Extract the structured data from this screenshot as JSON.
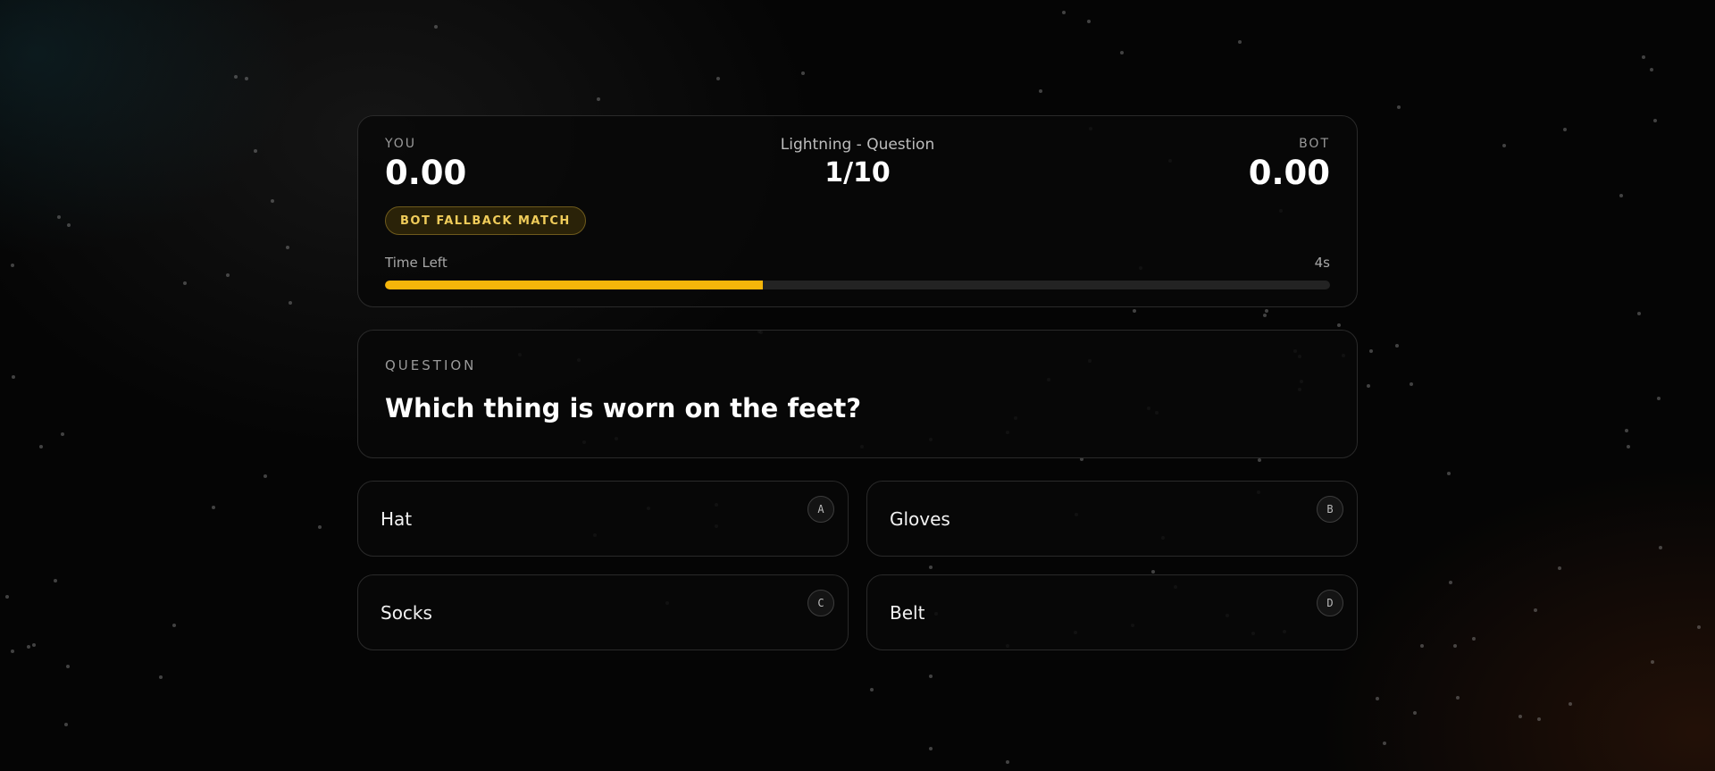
{
  "scoreboard": {
    "you_label": "YOU",
    "you_score": "0.00",
    "bot_label": "BOT",
    "bot_score": "0.00",
    "mode_label": "Lightning - Question",
    "question_counter": "1/10",
    "badge": "BOT FALLBACK MATCH",
    "time_label": "Time Left",
    "time_value": "4s",
    "time_fraction": 0.4
  },
  "question": {
    "heading": "QUESTION",
    "text": "Which thing is worn on the feet?"
  },
  "answers": [
    {
      "key": "A",
      "text": "Hat"
    },
    {
      "key": "B",
      "text": "Gloves"
    },
    {
      "key": "C",
      "text": "Socks"
    },
    {
      "key": "D",
      "text": "Belt"
    }
  ],
  "colors": {
    "accent": "#f5b50a",
    "badge_text": "#f0cc5a",
    "background": "#050505"
  }
}
